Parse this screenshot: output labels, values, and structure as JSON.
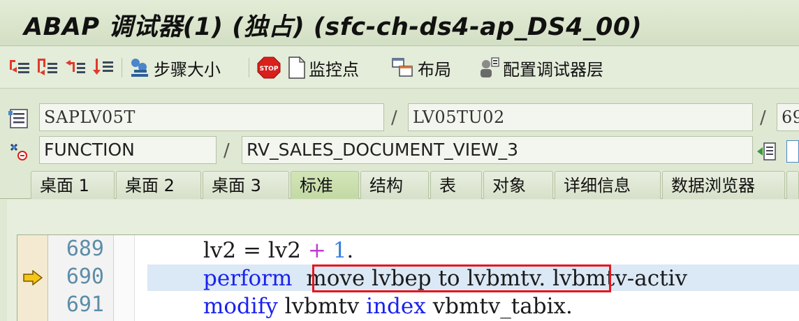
{
  "window": {
    "title": "ABAP 调试器(1)  (独占) (sfc-ch-ds4-ap_DS4_00)"
  },
  "toolbar": {
    "step_size": "步骤大小",
    "watchpoint": "监控点",
    "layout": "布局",
    "config_layers": "配置调试器层"
  },
  "location": {
    "program": "SAPLV05T",
    "include": "LV05TU02",
    "line_prefix": "69",
    "event_type": "FUNCTION",
    "event_name": "RV_SALES_DOCUMENT_VIEW_3",
    "separator": "/"
  },
  "tabs": [
    {
      "label": "桌面 1"
    },
    {
      "label": "桌面 2"
    },
    {
      "label": "桌面 3"
    },
    {
      "label": "标准",
      "active": true
    },
    {
      "label": "结构"
    },
    {
      "label": "表"
    },
    {
      "label": "对象"
    },
    {
      "label": "详细信息"
    },
    {
      "label": "数据浏览器"
    }
  ],
  "code": {
    "lines": [
      {
        "no": "689",
        "t1": "lv2 = lv2 ",
        "op": "+",
        "t2": " ",
        "num": "1",
        "t3": "."
      },
      {
        "no": "690",
        "kw": "perform",
        "highlight": "move lvbep to lvbmtv.",
        "rest": " lvbmtv-activ",
        "current": true
      },
      {
        "no": "691",
        "kw1": "modify",
        "t1": " lvbmtv ",
        "kw2": "index",
        "t2": " vbmtv_tabix."
      }
    ]
  },
  "colors": {
    "keyword": "#1a22ee",
    "number": "#3a7de0",
    "operator": "#c03ad0",
    "highlight_box": "#e8141c"
  }
}
